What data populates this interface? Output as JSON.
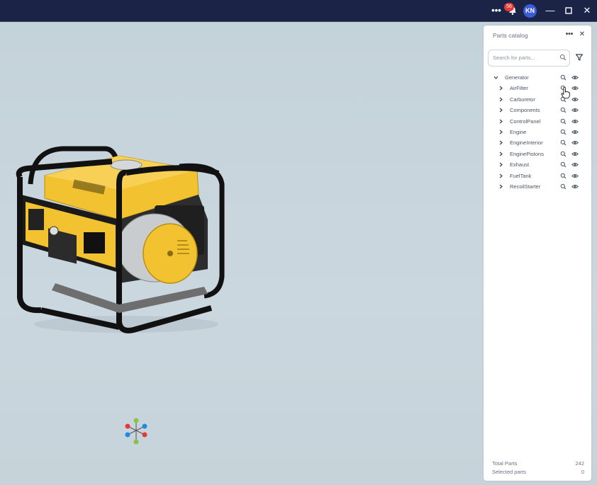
{
  "titlebar": {
    "more_label": "•••",
    "notification_count": "56",
    "avatar_initials": "KN",
    "minimize_glyph": "—",
    "maximize_glyph": "☐",
    "close_glyph": "✕"
  },
  "panel": {
    "title": "Parts catalog",
    "more_label": "•••",
    "close_glyph": "✕",
    "search": {
      "placeholder": "Search for parts...",
      "value": ""
    },
    "tree": {
      "root": "Generator",
      "children": [
        "AirFilter",
        "Carburetor",
        "Components",
        "ControlPanel",
        "Engine",
        "EngineInterior",
        "EnginePistons",
        "Exhaust",
        "FuelTank",
        "RecoilStarter"
      ]
    },
    "footer": {
      "total_label": "Total Parts",
      "total_value": "242",
      "selected_label": "Selected parts",
      "selected_value": "0"
    }
  },
  "colors": {
    "titlebar_bg": "#1b2347",
    "viewport_bg": "#c9d5dc",
    "avatar_bg": "#3d5bd9",
    "badge_bg": "#e53935",
    "generator_yellow": "#f2c230"
  },
  "icons": {
    "notification": "bell-icon",
    "search": "search-icon",
    "filter": "filter-icon",
    "row_zoom": "magnifier-icon",
    "row_visibility": "eye-icon",
    "expand": "chevron-right-icon",
    "collapse": "chevron-down-icon"
  }
}
